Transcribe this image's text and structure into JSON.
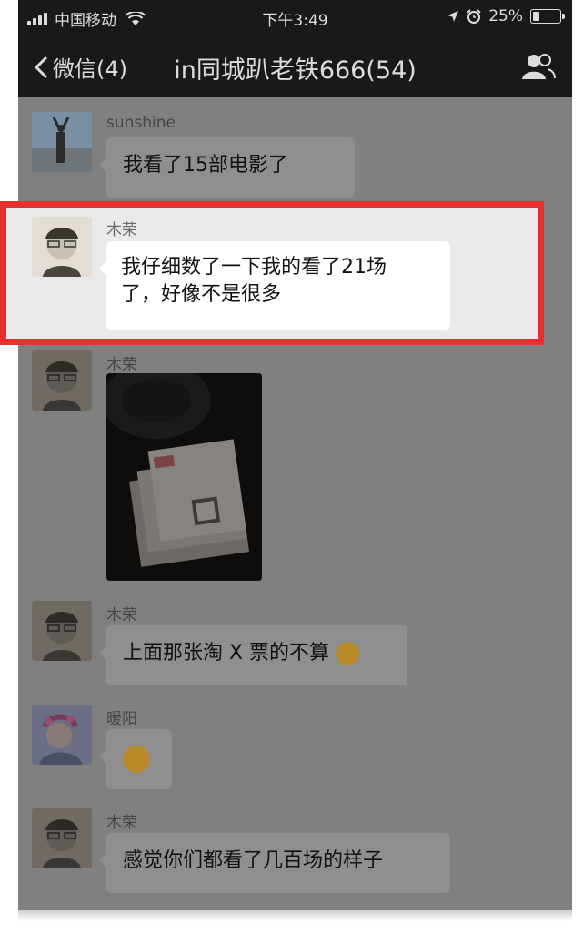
{
  "status_bar": {
    "carrier": "中国移动",
    "time": "下午3:49",
    "battery": "25%",
    "battery_level": 0.25
  },
  "nav": {
    "back_label": "微信(4)",
    "title": "in同城趴老铁666(54)"
  },
  "messages": [
    {
      "sender": "sunshine",
      "text": "我看了15部电影了"
    },
    {
      "sender": "木荣",
      "text_line1": "我仔细数了一下我的看了21场",
      "text_line2": "了，好像不是很多",
      "highlighted": true
    },
    {
      "sender": "木荣",
      "type": "image"
    },
    {
      "sender": "木荣",
      "text": "上面那张淘 X 票的不算"
    },
    {
      "sender": "暖阳",
      "type": "emoji"
    },
    {
      "sender": "木荣",
      "text": "感觉你们都看了几百场的样子"
    }
  ],
  "colors": {
    "overlay_gray": "#808080",
    "bar_dark": "#191919",
    "highlight_red": "#e8302f"
  }
}
